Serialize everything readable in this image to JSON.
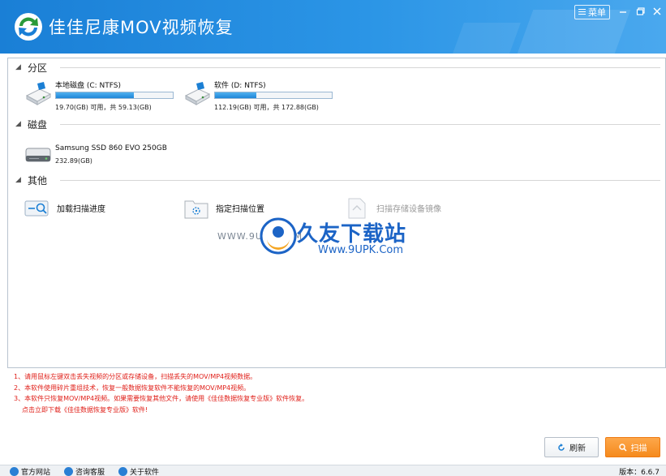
{
  "window": {
    "title": "佳佳尼康MOV视频恢复",
    "menu_label": "菜单",
    "colors": {
      "titlebar": "#1a7fd6",
      "accent_orange": "#f58a1d",
      "tip_red": "#e0201a"
    }
  },
  "sections": {
    "partitions": {
      "title": "分区",
      "drives": [
        {
          "name": "本地磁盘 (C: NTFS)",
          "size": "19.70(GB) 可用，共 59.13(GB)",
          "used_fraction": 0.667
        },
        {
          "name": "软件 (D: NTFS)",
          "size": "112.19(GB) 可用，共 172.88(GB)",
          "used_fraction": 0.351
        }
      ]
    },
    "disks": {
      "title": "磁盘",
      "items": [
        {
          "name": "Samsung SSD 860 EVO 250GB",
          "size": "232.89(GB)"
        }
      ]
    },
    "others": {
      "title": "其他",
      "items": [
        {
          "label": "加载扫描进度",
          "icon": "load-progress-icon"
        },
        {
          "label": "指定扫描位置",
          "icon": "target-scan-icon"
        },
        {
          "label": "扫描存储设备镜像",
          "icon": "disk-image-icon"
        }
      ]
    }
  },
  "watermark": {
    "brand": "久友下载站",
    "url": "Www.9UPK.Com",
    "left_text": "WWW.9UPK.COM"
  },
  "tips": [
    "1、请用鼠标左键双击丢失视频的分区或存储设备，扫描丢失的MOV/MP4视频数据。",
    "2、本软件使用碎片重组技术，恢复一般数据恢复软件不能恢复的MOV/MP4视频。",
    "3、本软件只恢复MOV/MP4视频。如果需要恢复其他文件，请使用《佳佳数据恢复专业版》软件恢复。",
    "点击立即下载《佳佳数据恢复专业版》软件!"
  ],
  "buttons": {
    "refresh": "刷新",
    "scan": "扫描"
  },
  "footer": {
    "links": [
      "官方网站",
      "咨询客服",
      "关于软件"
    ],
    "version": "版本：6.6.7"
  }
}
